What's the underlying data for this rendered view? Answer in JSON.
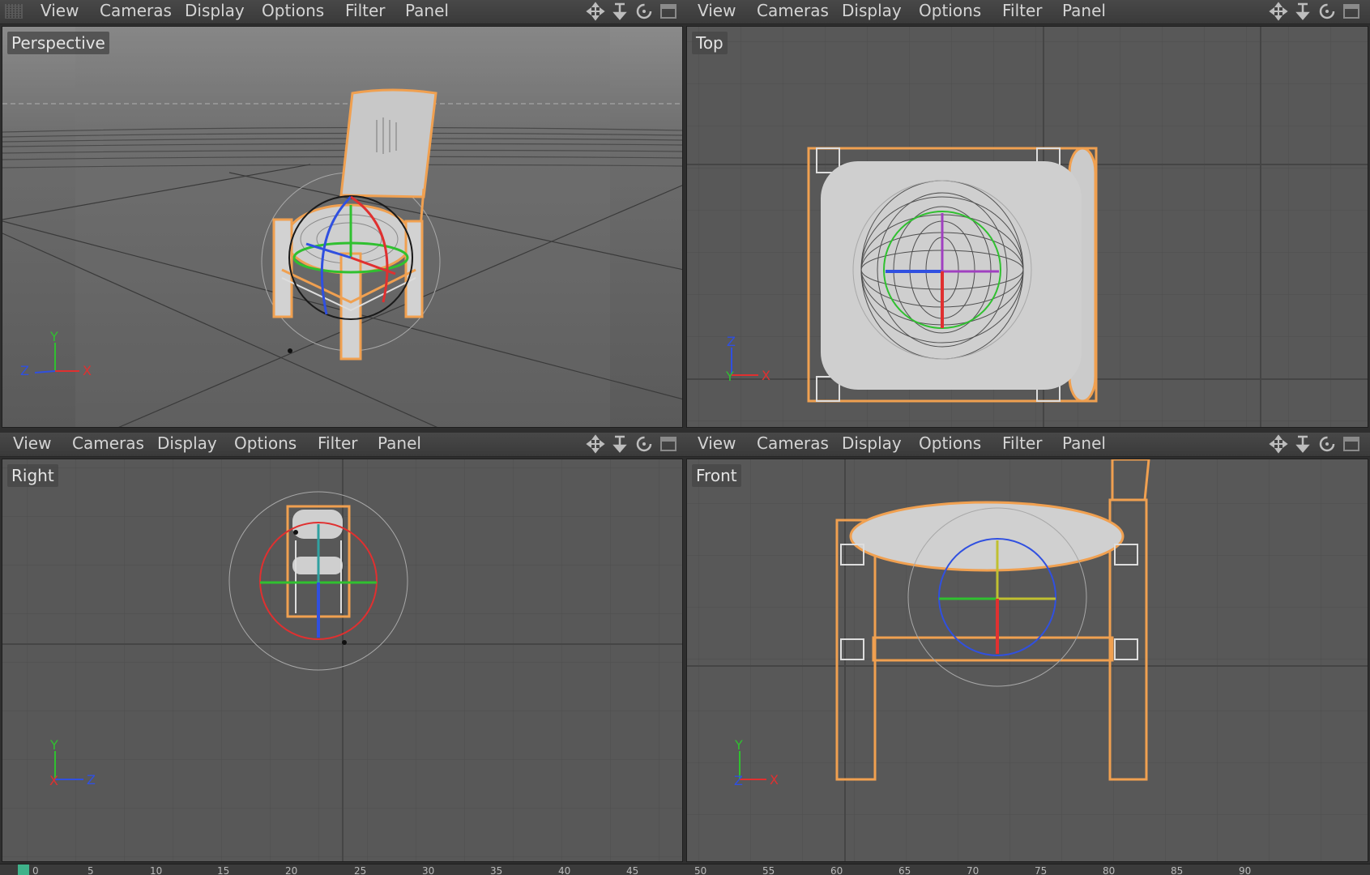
{
  "menu": [
    "View",
    "Cameras",
    "Display",
    "Options",
    "Filter",
    "Panel"
  ],
  "viewports": {
    "perspective": "Perspective",
    "top": "Top",
    "right": "Right",
    "front": "Front"
  },
  "axes": {
    "perspective": {
      "up": "Y",
      "left": "Z",
      "right": "X"
    },
    "top": {
      "up": "Z",
      "left": "Y",
      "right": "X"
    },
    "right": {
      "up": "Y",
      "left": "X",
      "right": "Z"
    },
    "front": {
      "up": "Y",
      "left": "Z",
      "right": "X"
    }
  },
  "nav_icons": [
    "move-icon",
    "zoom-icon",
    "rotate-icon",
    "maximize-icon"
  ],
  "timeline": {
    "frames": [
      "0",
      "5",
      "10",
      "15",
      "20",
      "25",
      "30",
      "35",
      "40",
      "45",
      "50",
      "55",
      "60",
      "65",
      "70",
      "75",
      "80",
      "85",
      "90"
    ],
    "current_frame": "0"
  },
  "colors": {
    "selection": "#f0a050",
    "grid_bg": "#585858",
    "axis_x": "#e03030",
    "axis_y": "#30c030",
    "axis_z": "#3050e0"
  }
}
